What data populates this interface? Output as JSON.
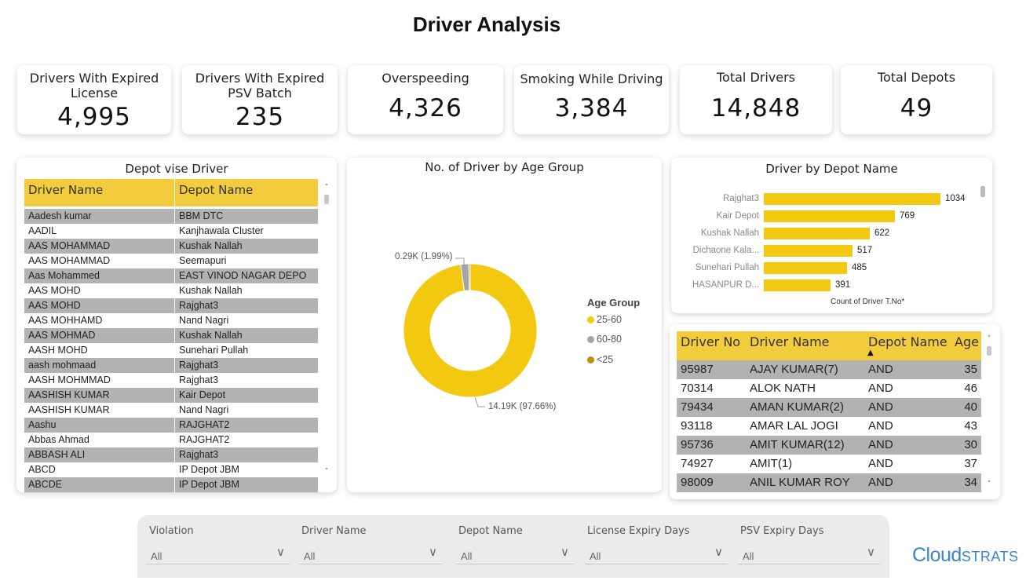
{
  "title": "Driver Analysis",
  "kpis": [
    {
      "label": "Drivers With Expired License",
      "value": "4,995"
    },
    {
      "label": "Drivers With Expired PSV Batch",
      "value": "235"
    },
    {
      "label": "Overspeeding",
      "value": "4,326"
    },
    {
      "label": "Smoking While Driving",
      "value": "3,384"
    },
    {
      "label": "Total Drivers",
      "value": "14,848"
    },
    {
      "label": "Total Depots",
      "value": "49"
    }
  ],
  "depot_table": {
    "title": "Depot vise Driver",
    "columns": [
      "Driver Name",
      "Depot Name"
    ],
    "rows": [
      [
        "Aadesh kumar",
        "BBM DTC"
      ],
      [
        "AADIL",
        "Kanjhawala Cluster"
      ],
      [
        "AAS MOHAMMAD",
        "Kushak Nallah"
      ],
      [
        "AAS MOHAMMAD",
        "Seemapuri"
      ],
      [
        "Aas Mohammed",
        "EAST VINOD NAGAR DEPO"
      ],
      [
        "AAS MOHD",
        "Kushak Nallah"
      ],
      [
        "AAS MOHD",
        "Rajghat3"
      ],
      [
        "AAS MOHHAMD",
        "Nand Nagri"
      ],
      [
        "AAS MOHMAD",
        "Kushak Nallah"
      ],
      [
        "AASH MOHD",
        "Sunehari Pullah"
      ],
      [
        "aash mohmaad",
        "Rajghat3"
      ],
      [
        "AASH MOHMMAD",
        "Rajghat3"
      ],
      [
        "AASHISH KUMAR",
        "Kair Depot"
      ],
      [
        "AASHISH KUMAR",
        "Nand Nagri"
      ],
      [
        "Aashu",
        "RAJGHAT2"
      ],
      [
        "Abbas Ahmad",
        "RAJGHAT2"
      ],
      [
        "ABBASH ALI",
        "Rajghat3"
      ],
      [
        "ABCD",
        "IP Depot JBM"
      ],
      [
        "ABCDE",
        "IP Depot JBM"
      ]
    ]
  },
  "age_chart": {
    "title": "No. of Driver by Age Group",
    "legend_title": "Age Group",
    "legend": [
      {
        "name": "25-60",
        "color": "#f2c811"
      },
      {
        "name": "60-80",
        "color": "#a5a5a5"
      },
      {
        "name": "<25",
        "color": "#b8900a"
      }
    ],
    "label_large": "14.19K (97.66%)",
    "label_small": "0.29K (1.99%)"
  },
  "depot_chart": {
    "title": "Driver by Depot Name",
    "xlabel": "Count of Driver T.No*"
  },
  "chart_data": [
    {
      "type": "pie",
      "title": "No. of Driver by Age Group",
      "legend_title": "Age Group",
      "categories": [
        "25-60",
        "60-80",
        "<25"
      ],
      "values": [
        14190,
        290,
        50
      ],
      "percents": [
        97.66,
        1.99,
        0.35
      ],
      "colors": [
        "#f2c811",
        "#a5a5a5",
        "#b8900a"
      ]
    },
    {
      "type": "bar",
      "orientation": "horizontal",
      "title": "Driver by Depot Name",
      "xlabel": "Count of Driver T.No*",
      "categories": [
        "Rajghat3",
        "Kair Depot",
        "Kushak Nallah",
        "Dichaone Kala...",
        "Sunehari Pullah",
        "HASANPUR D..."
      ],
      "values": [
        1034,
        769,
        622,
        517,
        485,
        391
      ],
      "xlim": [
        0,
        1034
      ],
      "color": "#f2c811"
    }
  ],
  "driver_table": {
    "columns": [
      "Driver No",
      "Driver Name",
      "Depot Name",
      "Age"
    ],
    "sort_indicator": "▲",
    "rows": [
      [
        "95987",
        "AJAY KUMAR(7)",
        "AND",
        "35"
      ],
      [
        "70314",
        "ALOK NATH",
        "AND",
        "46"
      ],
      [
        "79434",
        "AMAN KUMAR(2)",
        "AND",
        "40"
      ],
      [
        "93118",
        "AMAR LAL JOGI",
        "AND",
        "43"
      ],
      [
        "95736",
        "AMIT KUMAR(12)",
        "AND",
        "30"
      ],
      [
        "74927",
        "AMIT(1)",
        "AND",
        "37"
      ],
      [
        "98009",
        "ANIL KUMAR ROY",
        "AND",
        "34"
      ]
    ]
  },
  "filters": [
    {
      "label": "Violation",
      "value": "All"
    },
    {
      "label": "Driver Name",
      "value": "All"
    },
    {
      "label": "Depot Name",
      "value": "All"
    },
    {
      "label": "License Expiry Days",
      "value": "All"
    },
    {
      "label": "PSV Expiry Days",
      "value": "All"
    }
  ],
  "logo": {
    "part1": "Cloud",
    "part2": "STRATS"
  }
}
